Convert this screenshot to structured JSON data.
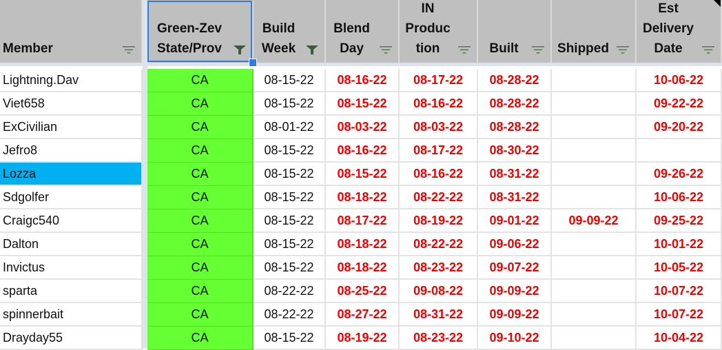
{
  "columns": [
    {
      "key": "member",
      "label_lines": [
        "Member"
      ],
      "filter": "sort"
    },
    {
      "key": "state",
      "label_lines": [
        "Green-Zev",
        "State/Prov"
      ],
      "filter": "active"
    },
    {
      "key": "build_week",
      "label_lines": [
        "Build",
        "Week"
      ],
      "filter": "active"
    },
    {
      "key": "blend_day",
      "label_lines": [
        "Blend",
        "Day"
      ],
      "filter": "sort"
    },
    {
      "key": "in_production",
      "label_lines": [
        "IN",
        "Produc",
        "tion"
      ],
      "filter": "sort"
    },
    {
      "key": "built",
      "label_lines": [
        "Built"
      ],
      "filter": "sort"
    },
    {
      "key": "shipped",
      "label_lines": [
        "Shipped"
      ],
      "filter": "sort"
    },
    {
      "key": "est_delivery",
      "label_lines": [
        "Est",
        "Delivery",
        "Date"
      ],
      "filter": "sort"
    }
  ],
  "colors": {
    "state_fill": "#66ff33",
    "date_red": "#ee0000",
    "selected_row": "#00b0f0",
    "header_bg": "#bfbfbf",
    "selection_border": "#2f7be3"
  },
  "selected_member": "Lozza",
  "rows": [
    {
      "member": "Lightning.Dav",
      "state": "CA",
      "build_week": "08-15-22",
      "blend_day": "08-16-22",
      "in_production": "08-17-22",
      "built": "08-28-22",
      "shipped": "",
      "est_delivery": "10-06-22"
    },
    {
      "member": "Viet658",
      "state": "CA",
      "build_week": "08-15-22",
      "blend_day": "08-15-22",
      "in_production": "08-16-22",
      "built": "08-28-22",
      "shipped": "",
      "est_delivery": "09-22-22"
    },
    {
      "member": "ExCivilian",
      "state": "CA",
      "build_week": "08-01-22",
      "blend_day": "08-03-22",
      "in_production": "08-03-22",
      "built": "08-28-22",
      "shipped": "",
      "est_delivery": "09-20-22"
    },
    {
      "member": "Jefro8",
      "state": "CA",
      "build_week": "08-15-22",
      "blend_day": "08-16-22",
      "in_production": "08-17-22",
      "built": "08-30-22",
      "shipped": "",
      "est_delivery": ""
    },
    {
      "member": "Lozza",
      "state": "CA",
      "build_week": "08-15-22",
      "blend_day": "08-15-22",
      "in_production": "08-16-22",
      "built": "08-31-22",
      "shipped": "",
      "est_delivery": "09-26-22"
    },
    {
      "member": "Sdgolfer",
      "state": "CA",
      "build_week": "08-15-22",
      "blend_day": "08-18-22",
      "in_production": "08-22-22",
      "built": "08-31-22",
      "shipped": "",
      "est_delivery": "10-06-22"
    },
    {
      "member": "Craigc540",
      "state": "CA",
      "build_week": "08-15-22",
      "blend_day": "08-17-22",
      "in_production": "08-19-22",
      "built": "09-01-22",
      "shipped": "09-09-22",
      "est_delivery": "09-25-22"
    },
    {
      "member": "Dalton",
      "state": "CA",
      "build_week": "08-15-22",
      "blend_day": "08-18-22",
      "in_production": "08-22-22",
      "built": "09-06-22",
      "shipped": "",
      "est_delivery": "10-01-22"
    },
    {
      "member": "Invictus",
      "state": "CA",
      "build_week": "08-15-22",
      "blend_day": "08-18-22",
      "in_production": "08-23-22",
      "built": "09-07-22",
      "shipped": "",
      "est_delivery": "10-05-22"
    },
    {
      "member": "sparta",
      "state": "CA",
      "build_week": "08-22-22",
      "blend_day": "08-25-22",
      "in_production": "09-08-22",
      "built": "09-09-22",
      "shipped": "",
      "est_delivery": "10-07-22"
    },
    {
      "member": "spinnerbait",
      "state": "CA",
      "build_week": "08-22-22",
      "blend_day": "08-27-22",
      "in_production": "08-31-22",
      "built": "09-09-22",
      "shipped": "",
      "est_delivery": "10-07-22"
    },
    {
      "member": "Drayday55",
      "state": "CA",
      "build_week": "08-15-22",
      "blend_day": "08-19-22",
      "in_production": "08-23-22",
      "built": "09-10-22",
      "shipped": "",
      "est_delivery": "10-04-22"
    }
  ]
}
